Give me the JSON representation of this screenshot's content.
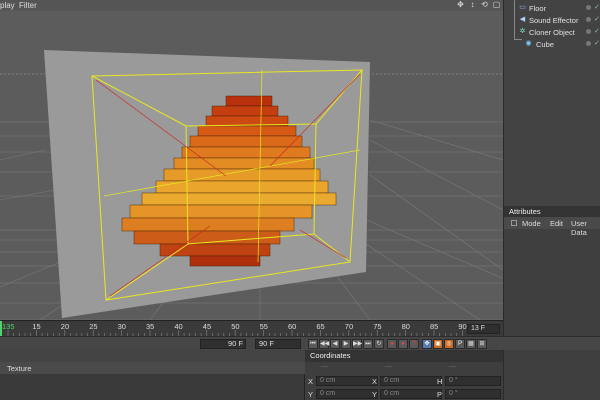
{
  "viewport": {
    "menu": [
      "play",
      "Filter"
    ],
    "nav_icons": [
      "move-view-icon",
      "scale-view-icon",
      "rotate-view-icon",
      "maximize-icon"
    ],
    "nav_glyphs": [
      "✥",
      "↕",
      "⟲",
      "▢"
    ]
  },
  "object_manager": {
    "objects": [
      {
        "label": "Floor",
        "icon": "floor-icon",
        "glyph": "▭",
        "indent": 0
      },
      {
        "label": "Sound Effector",
        "icon": "sound-effector-icon",
        "glyph": "◀",
        "indent": 0
      },
      {
        "label": "Cloner Object",
        "icon": "cloner-icon",
        "glyph": "✲",
        "indent": 0
      },
      {
        "label": "Cube",
        "icon": "cube-icon",
        "glyph": "◉",
        "indent": 1
      }
    ],
    "check": "✓"
  },
  "attributes": {
    "title": "Attributes",
    "menu": [
      "Mode",
      "Edit",
      "User Data"
    ]
  },
  "timeline": {
    "frames": [
      "135",
      "15",
      "20",
      "25",
      "30",
      "35",
      "40",
      "45",
      "50",
      "55",
      "60",
      "65",
      "70",
      "75",
      "80",
      "85",
      "90"
    ],
    "current_frame": "13 F",
    "accent": "#4fd36a"
  },
  "transport": {
    "end_frame": "90 F",
    "max_frame": "90 F",
    "buttons": [
      "⏮",
      "◀◀",
      "◀",
      "▶",
      "▶▶",
      "⏭",
      "↻"
    ],
    "record_buttons": [
      "●",
      "●",
      "?"
    ],
    "key_buttons": [
      "✥",
      "▣",
      "◎",
      "P",
      "▦",
      "⊞"
    ]
  },
  "material": {
    "tab": "Texture"
  },
  "coordinates": {
    "title": "Coordinates",
    "headers": [
      "---",
      "---",
      "---"
    ],
    "rows": [
      {
        "axis": "X",
        "pos": "0 cm",
        "size_axis": "X",
        "size": "0 cm",
        "rot_axis": "H",
        "rot": "0 °"
      },
      {
        "axis": "Y",
        "pos": "0 cm",
        "size_axis": "Y",
        "size": "0 cm",
        "rot_axis": "P",
        "rot": "0 °"
      }
    ]
  }
}
